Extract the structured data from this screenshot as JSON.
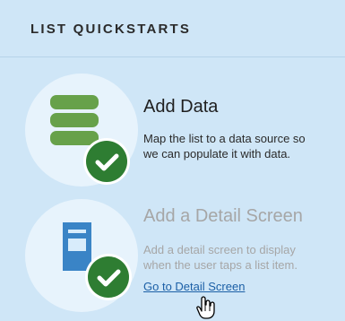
{
  "header": {
    "title": "LIST QUICKSTARTS"
  },
  "quickstarts": [
    {
      "title": "Add Data",
      "description_lines": [
        "Map the list to a data source so",
        "we can populate it with data."
      ],
      "icon": "database-icon",
      "status_icon": "check-icon"
    },
    {
      "title": "Add a Detail Screen",
      "description_lines": [
        "Add a detail screen to display",
        "when the user taps a list item."
      ],
      "link_text": "Go to Detail Screen",
      "icon": "document-icon",
      "status_icon": "check-icon"
    }
  ],
  "colors": {
    "panel_background": "#cfe6f7",
    "circle_background": "#e7f3fc",
    "check_green": "#2e7d32",
    "database_green": "#67a14a",
    "document_blue": "#3a84c6",
    "link_blue": "#1b5fa6",
    "muted_gray": "#a6a6a6"
  }
}
